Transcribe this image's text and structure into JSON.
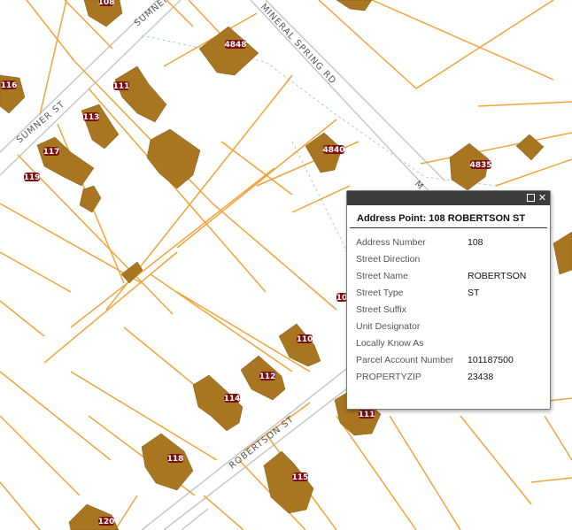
{
  "map": {
    "streets": [
      "SUMNER ST",
      "SUMNER ST",
      "MINERAL SPRING RD",
      "ROBERTSON ST",
      "M"
    ],
    "buildings": [
      "108",
      "116",
      "111",
      "113",
      "4848",
      "117",
      "119",
      "4840",
      "4835",
      "110",
      "112",
      "114",
      "111",
      "118",
      "115",
      "120",
      "10"
    ],
    "colors": {
      "parcel": "#f2a33a",
      "building": "#a87520",
      "road": "#c8c8c8",
      "popup_bar": "#3c3c3c"
    }
  },
  "popup": {
    "title": "Address Point: 108 ROBERTSON ST",
    "maximize_icon": "maximize-icon",
    "close_icon": "close-icon",
    "close_glyph": "✕",
    "fields": [
      {
        "label": "Address Number",
        "value": "108"
      },
      {
        "label": "Street Direction",
        "value": ""
      },
      {
        "label": "Street Name",
        "value": "ROBERTSON"
      },
      {
        "label": "Street Type",
        "value": "ST"
      },
      {
        "label": "Street Suffix",
        "value": ""
      },
      {
        "label": "Unit Designator",
        "value": ""
      },
      {
        "label": "Locally Know As",
        "value": ""
      },
      {
        "label": "Parcel Account Number",
        "value": "101187500"
      },
      {
        "label": "PROPERTYZIP",
        "value": "23438"
      }
    ]
  }
}
